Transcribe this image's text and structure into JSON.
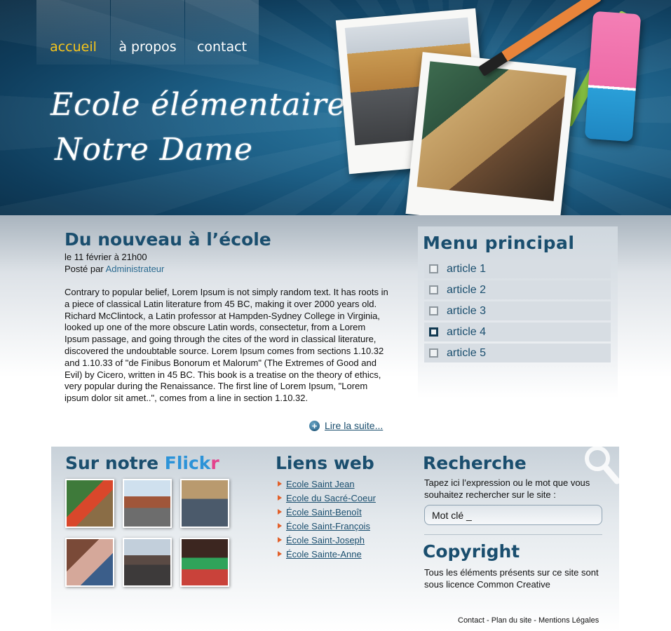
{
  "nav": {
    "items": [
      {
        "label": "accueil",
        "active": true
      },
      {
        "label": "à propos",
        "active": false
      },
      {
        "label": "contact",
        "active": false
      }
    ]
  },
  "header": {
    "title_line1": "Ecole élémentaire",
    "title_line2": "Notre Dame"
  },
  "article": {
    "title": "Du nouveau à l’école",
    "date": "le 11 février à 21h00",
    "posted_by": "Posté par",
    "author": "Administrateur",
    "body": "Contrary to popular belief, Lorem Ipsum is not simply random text. It has roots in a piece of classical Latin literature from 45 BC, making it over 2000 years old. Richard McClintock, a Latin professor at Hampden-Sydney College in Virginia, looked up one of the more obscure Latin words, consectetur, from a Lorem Ipsum passage, and going through the cites of the word in classical literature, discovered the undoubtable source. Lorem Ipsum comes from sections 1.10.32 and 1.10.33 of \"de Finibus Bonorum et Malorum\" (The Extremes of Good and Evil) by Cicero, written in 45 BC. This book is a treatise on the theory of ethics, very popular during the Renaissance. The first line of Lorem Ipsum, \"Lorem ipsum dolor sit amet..\", comes from a line in section 1.10.32.",
    "read_more": "Lire la suite..."
  },
  "menu": {
    "title": "Menu  principal",
    "items": [
      {
        "label": "article 1",
        "active": false
      },
      {
        "label": "article 2",
        "active": false
      },
      {
        "label": "article 3",
        "active": false
      },
      {
        "label": "article 4",
        "active": true
      },
      {
        "label": "article 5",
        "active": false
      }
    ]
  },
  "flickr": {
    "title_prefix": "Sur notre ",
    "title_flick": "Flick",
    "title_r": "r"
  },
  "liens": {
    "title": "Liens web",
    "items": [
      "Ecole Saint Jean",
      "Ecole du Sacré-Coeur",
      "École Saint-Benoît",
      "École Saint-François",
      "École Saint-Joseph ",
      "École Sainte-Anne"
    ]
  },
  "search": {
    "title": "Recherche",
    "description": "Tapez ici l’expression ou le mot que vous souhaitez rechercher sur le site :",
    "placeholder": "Mot clé _"
  },
  "copyright": {
    "title": "Copyright",
    "text": "Tous les éléments présents sur ce site sont sous licence Common Creative"
  },
  "footer": {
    "contact": "Contact",
    "sitemap": "Plan du site",
    "legal": "Mentions Légales",
    "separator": " - "
  },
  "colors": {
    "header_blue": "#1d5f86",
    "title_blue": "#1a4e6e",
    "nav_active": "#f7c51b",
    "flickr_blue": "#2c93d8",
    "flickr_pink": "#e4428c",
    "arrow_orange": "#e2602a"
  },
  "icons": [
    "plus-icon",
    "checkbox-icon",
    "arrow-icon",
    "magnifier-icon"
  ]
}
